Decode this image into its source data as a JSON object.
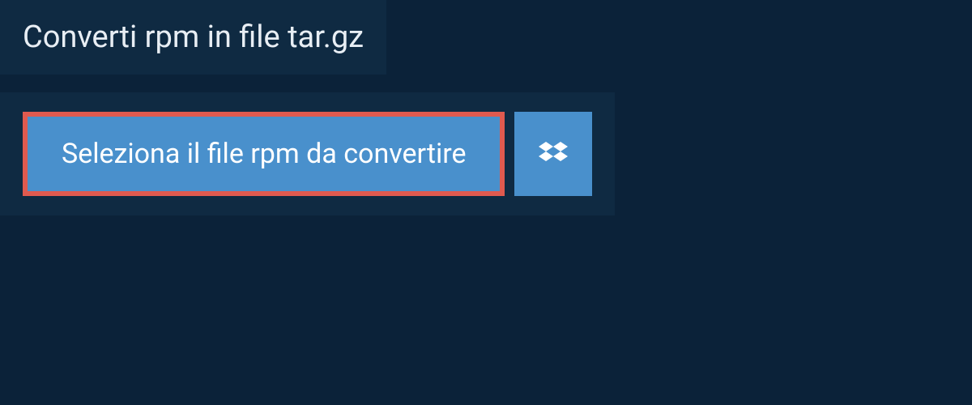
{
  "header": {
    "title": "Converti rpm in file tar.gz"
  },
  "upload": {
    "select_button_label": "Seleziona il file rpm da convertire"
  },
  "colors": {
    "page_bg": "#0b2239",
    "panel_bg": "#0f2a42",
    "button_bg": "#4990cc",
    "highlight_border": "#e05a4f",
    "text_light": "#e8eef4"
  }
}
